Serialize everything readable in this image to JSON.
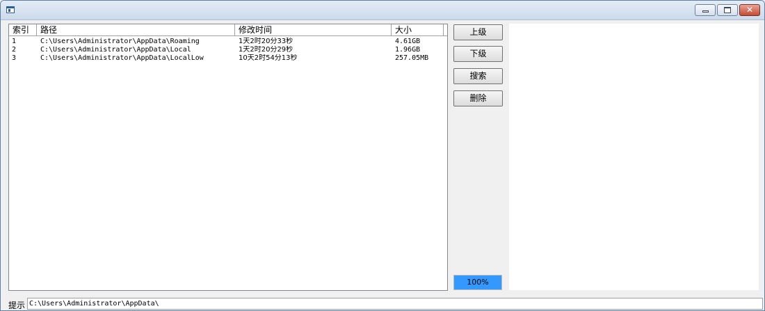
{
  "window": {
    "title": ""
  },
  "list": {
    "columns": [
      "索引",
      "路径",
      "修改时间",
      "大小"
    ],
    "rows": [
      {
        "index": "1",
        "path": "C:\\Users\\Administrator\\AppData\\Roaming",
        "modified": "1天2时20分33秒",
        "size": "4.61GB"
      },
      {
        "index": "2",
        "path": "C:\\Users\\Administrator\\AppData\\Local",
        "modified": "1天2时20分29秒",
        "size": "1.96GB"
      },
      {
        "index": "3",
        "path": "C:\\Users\\Administrator\\AppData\\LocalLow",
        "modified": "10天2时54分13秒",
        "size": "257.05MB"
      }
    ]
  },
  "buttons": {
    "up": "上级",
    "down": "下级",
    "search": "搜索",
    "delete": "删除"
  },
  "progress": {
    "label": "100%",
    "value": 100,
    "color": "#3399ff"
  },
  "status": {
    "label": "提示",
    "value": "C:\\Users\\Administrator\\AppData\\"
  }
}
